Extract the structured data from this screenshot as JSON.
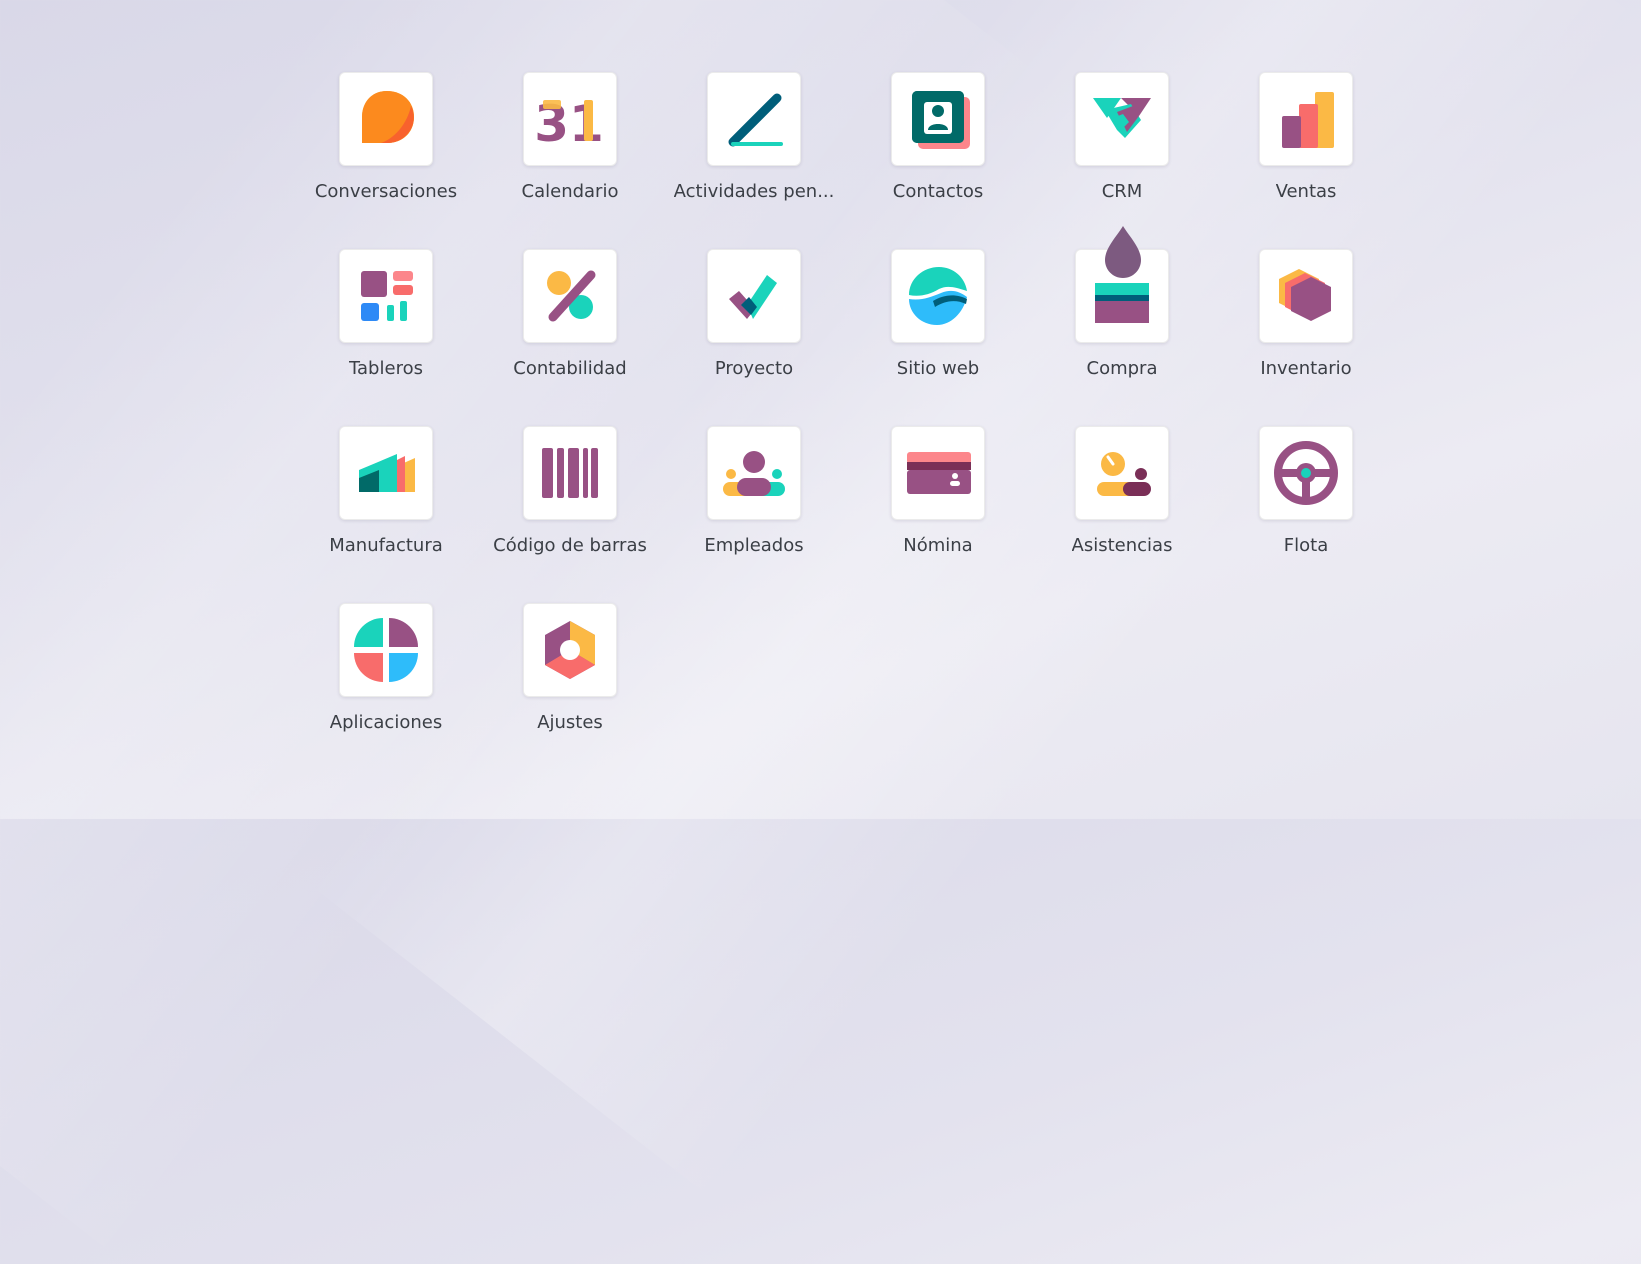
{
  "apps": [
    {
      "label": "Conversaciones",
      "icon": "conversations-icon"
    },
    {
      "label": "Calendario",
      "icon": "calendar-icon"
    },
    {
      "label": "Actividades pen...",
      "icon": "activities-icon"
    },
    {
      "label": "Contactos",
      "icon": "contacts-icon"
    },
    {
      "label": "CRM",
      "icon": "crm-icon"
    },
    {
      "label": "Ventas",
      "icon": "sales-icon"
    },
    {
      "label": "Tableros",
      "icon": "dashboards-icon"
    },
    {
      "label": "Contabilidad",
      "icon": "accounting-icon"
    },
    {
      "label": "Proyecto",
      "icon": "project-icon"
    },
    {
      "label": "Sitio web",
      "icon": "website-icon"
    },
    {
      "label": "Compra",
      "icon": "purchase-icon"
    },
    {
      "label": "Inventario",
      "icon": "inventory-icon"
    },
    {
      "label": "Manufactura",
      "icon": "manufacturing-icon"
    },
    {
      "label": "Código de barras",
      "icon": "barcode-icon"
    },
    {
      "label": "Empleados",
      "icon": "employees-icon"
    },
    {
      "label": "Nómina",
      "icon": "payroll-icon"
    },
    {
      "label": "Asistencias",
      "icon": "attendances-icon"
    },
    {
      "label": "Flota",
      "icon": "fleet-icon"
    },
    {
      "label": "Aplicaciones",
      "icon": "apps-icon"
    },
    {
      "label": "Ajustes",
      "icon": "settings-icon"
    }
  ],
  "calendar_day": "31",
  "colors": {
    "purple": "#985184",
    "teal": "#1ad3bb",
    "dark_teal": "#005e7a",
    "orange": "#fc868b",
    "yellow": "#fbb945",
    "coral": "#f86c6b",
    "blue": "#2ebcfa",
    "label_text": "#3b3f46"
  }
}
